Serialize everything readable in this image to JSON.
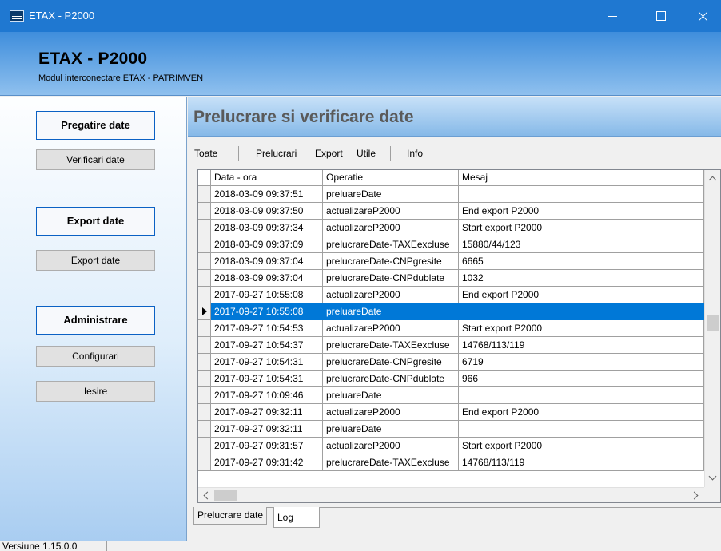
{
  "window": {
    "title": "ETAX - P2000",
    "icon": "etax-app-icon"
  },
  "header": {
    "title": "ETAX - P2000",
    "subtitle": "Modul interconectare ETAX - PATRIMVEN"
  },
  "sidebar": {
    "buttons": [
      {
        "label": "Pregatire date",
        "kind": "group"
      },
      {
        "label": "Verificari date",
        "kind": "sub"
      },
      {
        "label": "Export date",
        "kind": "group"
      },
      {
        "label": "Export date",
        "kind": "sub"
      },
      {
        "label": "Administrare",
        "kind": "group"
      },
      {
        "label": "Configurari",
        "kind": "sub"
      },
      {
        "label": "Iesire",
        "kind": "sub"
      }
    ]
  },
  "content": {
    "title": "Prelucrare si verificare date"
  },
  "menu": {
    "items": [
      "Toate",
      "Prelucrari",
      "Export",
      "Utile",
      "Info"
    ]
  },
  "grid": {
    "columns": [
      "Data - ora",
      "Operatie",
      "Mesaj"
    ],
    "selected_row": 7,
    "rows": [
      [
        "2018-03-09 09:37:51",
        "preluareDate",
        ""
      ],
      [
        "2018-03-09 09:37:50",
        "actualizareP2000",
        "End export P2000"
      ],
      [
        "2018-03-09 09:37:34",
        "actualizareP2000",
        "Start export P2000"
      ],
      [
        "2018-03-09 09:37:09",
        "prelucrareDate-TAXEexcluse",
        "15880/44/123"
      ],
      [
        "2018-03-09 09:37:04",
        "prelucrareDate-CNPgresite",
        "6665"
      ],
      [
        "2018-03-09 09:37:04",
        "prelucrareDate-CNPdublate",
        "1032"
      ],
      [
        "2017-09-27 10:55:08",
        "actualizareP2000",
        "End export P2000"
      ],
      [
        "2017-09-27 10:55:08",
        "preluareDate",
        ""
      ],
      [
        "2017-09-27 10:54:53",
        "actualizareP2000",
        "Start export P2000"
      ],
      [
        "2017-09-27 10:54:37",
        "prelucrareDate-TAXEexcluse",
        "14768/113/119"
      ],
      [
        "2017-09-27 10:54:31",
        "prelucrareDate-CNPgresite",
        "6719"
      ],
      [
        "2017-09-27 10:54:31",
        "prelucrareDate-CNPdublate",
        "966"
      ],
      [
        "2017-09-27 10:09:46",
        "preluareDate",
        ""
      ],
      [
        "2017-09-27 09:32:11",
        "actualizareP2000",
        "End export P2000"
      ],
      [
        "2017-09-27 09:32:11",
        "preluareDate",
        ""
      ],
      [
        "2017-09-27 09:31:57",
        "actualizareP2000",
        "Start export P2000"
      ],
      [
        "2017-09-27 09:31:42",
        "prelucrareDate-TAXEexcluse",
        "14768/113/119"
      ]
    ]
  },
  "tabs": {
    "items": [
      "Prelucrare date",
      "Log"
    ],
    "active": 1
  },
  "status": {
    "version": "Versiune 1.15.0.0"
  }
}
